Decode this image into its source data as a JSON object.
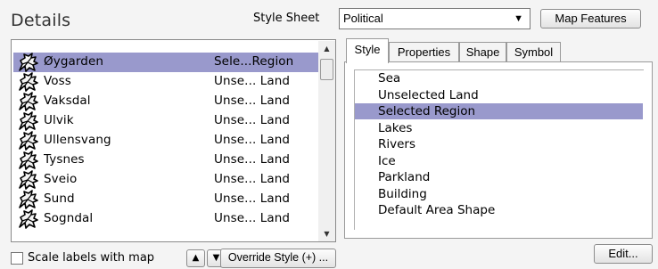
{
  "header": {
    "title": "Details",
    "style_sheet_label": "Style Sheet",
    "style_sheet_value": "Political",
    "map_features_label": "Map Features"
  },
  "regions": [
    {
      "name": "Øygarden",
      "style": "Sele...Region",
      "selected": true
    },
    {
      "name": "Voss",
      "style": "Unse... Land",
      "selected": false
    },
    {
      "name": "Vaksdal",
      "style": "Unse... Land",
      "selected": false
    },
    {
      "name": "Ulvik",
      "style": "Unse... Land",
      "selected": false
    },
    {
      "name": "Ullensvang",
      "style": "Unse... Land",
      "selected": false
    },
    {
      "name": "Tysnes",
      "style": "Unse... Land",
      "selected": false
    },
    {
      "name": "Sveio",
      "style": "Unse... Land",
      "selected": false
    },
    {
      "name": "Sund",
      "style": "Unse... Land",
      "selected": false
    },
    {
      "name": "Sogndal",
      "style": "Unse... Land",
      "selected": false
    }
  ],
  "bottom_left": {
    "scale_labels_label": "Scale labels with map",
    "scale_labels_checked": false,
    "move_up_symbol": "▲",
    "move_down_symbol": "▼",
    "override_style_label": "Override Style (+) ..."
  },
  "tabs": [
    {
      "label": "Style",
      "active": true
    },
    {
      "label": "Properties",
      "active": false
    },
    {
      "label": "Shape",
      "active": false
    },
    {
      "label": "Symbol",
      "active": false
    }
  ],
  "styles": [
    {
      "label": "Sea",
      "selected": false
    },
    {
      "label": "Unselected Land",
      "selected": false
    },
    {
      "label": "Selected Region",
      "selected": true
    },
    {
      "label": "Lakes",
      "selected": false
    },
    {
      "label": "Rivers",
      "selected": false
    },
    {
      "label": "Ice",
      "selected": false
    },
    {
      "label": "Parkland",
      "selected": false
    },
    {
      "label": "Building",
      "selected": false
    },
    {
      "label": "Default Area Shape",
      "selected": false
    }
  ],
  "edit_label": "Edit...",
  "icons": {
    "region_icon": "region-shape-icon",
    "dropdown": "chevron-down-icon",
    "scroll_up": "scroll-up-icon",
    "scroll_down": "scroll-down-icon"
  },
  "colors": {
    "selection": "#9999cc",
    "panel_bg": "#f4f4f4"
  }
}
